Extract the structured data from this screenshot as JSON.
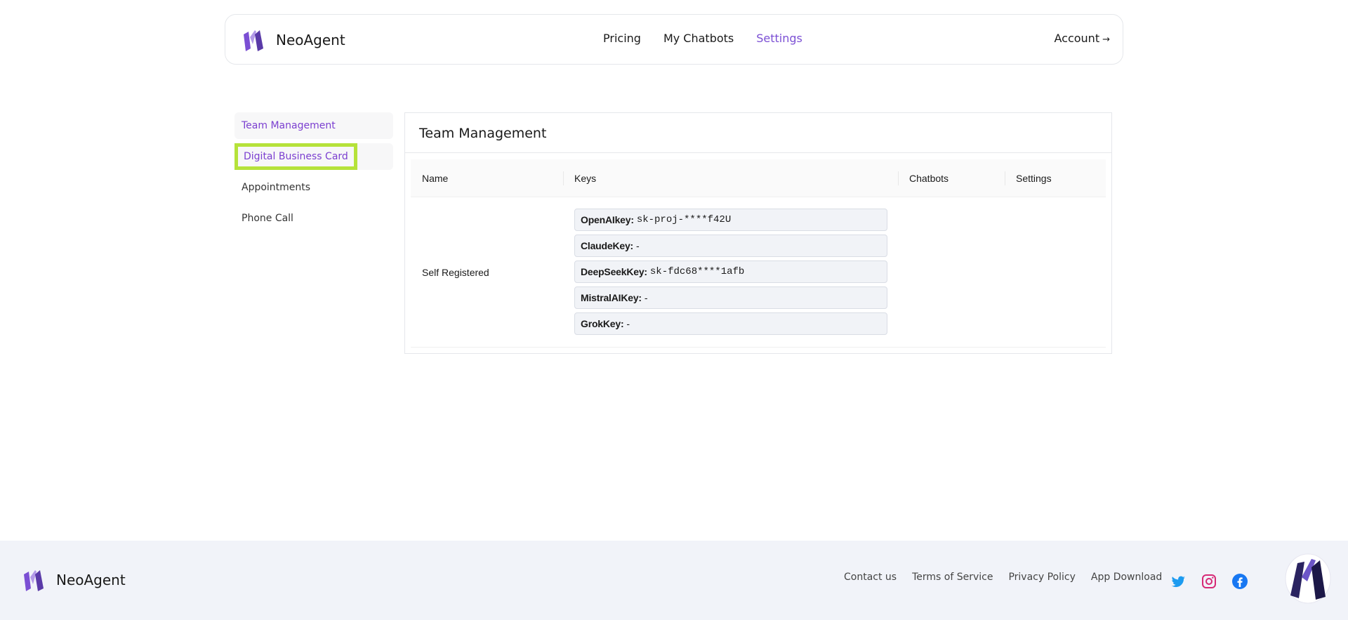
{
  "brand": {
    "name": "NeoAgent"
  },
  "nav": {
    "items": [
      "Pricing",
      "My Chatbots",
      "Settings"
    ],
    "active": "Settings"
  },
  "account": {
    "label": "Account",
    "arrow": "→"
  },
  "sidebar": {
    "items": [
      {
        "label": "Team Management"
      },
      {
        "label": "Digital Business Card"
      },
      {
        "label": "Appointments"
      },
      {
        "label": "Phone Call"
      }
    ]
  },
  "panel": {
    "title": "Team Management",
    "columns": [
      "Name",
      "Keys",
      "Chatbots",
      "Settings"
    ],
    "rows": [
      {
        "name": "Self Registered",
        "keys": [
          {
            "label": "OpenAIkey:",
            "value": "sk-proj-****f42U"
          },
          {
            "label": "ClaudeKey:",
            "value": "-"
          },
          {
            "label": "DeepSeekKey:",
            "value": "sk-fdc68****1afb"
          },
          {
            "label": "MistralAIKey:",
            "value": "-"
          },
          {
            "label": "GrokKey:",
            "value": "-"
          }
        ]
      }
    ]
  },
  "footer": {
    "brand": "NeoAgent",
    "links": [
      "Contact us",
      "Terms of Service",
      "Privacy Policy",
      "App Download"
    ],
    "social_icons": [
      "twitter-icon",
      "instagram-icon",
      "facebook-icon"
    ]
  },
  "colors": {
    "accent": "#7b4fd4",
    "highlight": "#b5e23a",
    "footer_bg": "#f1f3f9"
  }
}
